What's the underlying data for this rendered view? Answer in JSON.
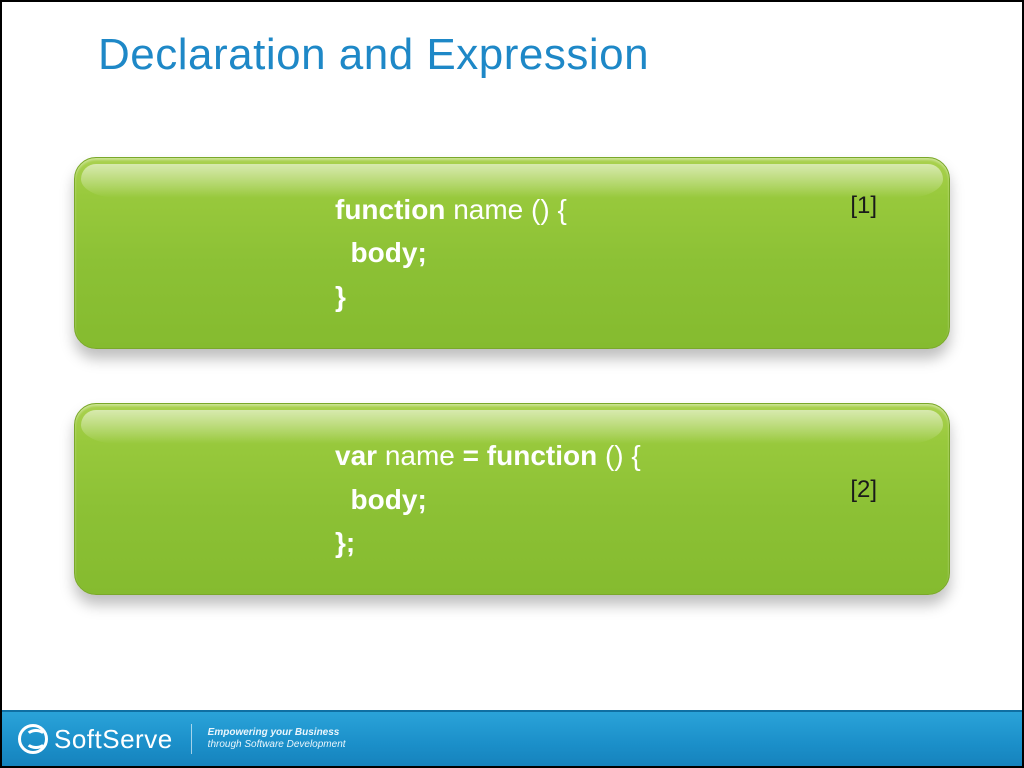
{
  "title": "Declaration and Expression",
  "blocks": [
    {
      "badge": "[1]",
      "line1_kw": "function",
      "line1_rest": " name () {",
      "line2": "  body;",
      "line3": "}"
    },
    {
      "badge": "[2]",
      "line1_kw": "var",
      "line1_mid": " name ",
      "line1_kw2": "= function",
      "line1_rest": " () {",
      "line2": "  body;",
      "line3": "};"
    }
  ],
  "footer": {
    "brand_left": "Soft",
    "brand_right": "Serve",
    "tag1": "Empowering your Business",
    "tag2": "through Software Development"
  }
}
